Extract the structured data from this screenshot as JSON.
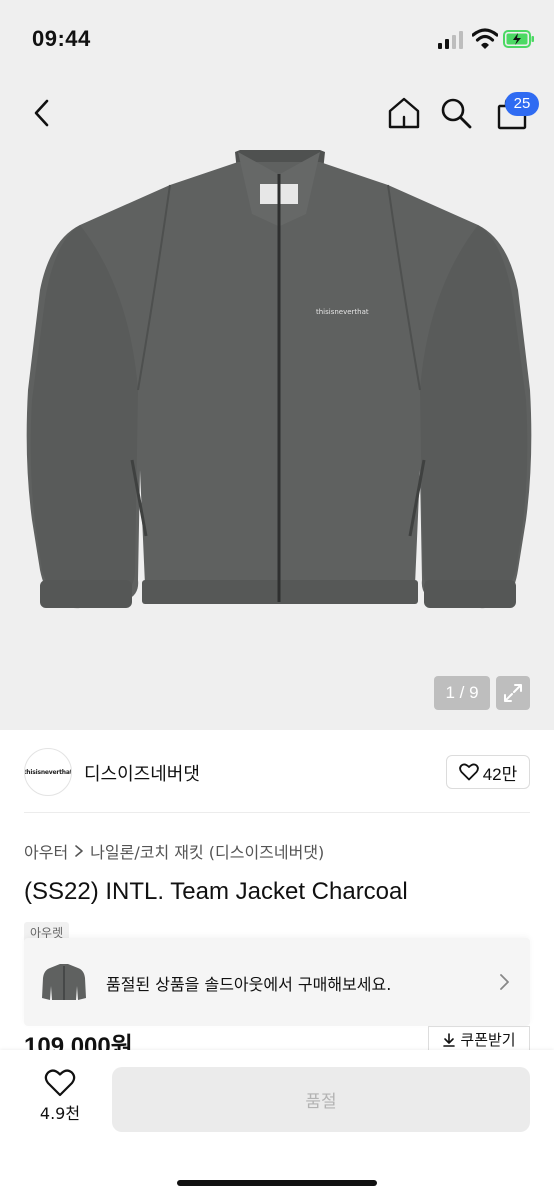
{
  "status_bar": {
    "time": "09:44"
  },
  "nav": {
    "cart_count": "25"
  },
  "gallery": {
    "counter": "1 / 9",
    "jacket_logo_text": "thisisneverthat"
  },
  "brand": {
    "logo_text": "thisisneverthat",
    "name": "디스이즈네버댓",
    "likes": "42만"
  },
  "breadcrumb": {
    "category": "아우터",
    "subcategory": "나일론/코치 재킷 (디스이즈네버댓)"
  },
  "product": {
    "title": "(SS22) INTL. Team Jacket Charcoal",
    "tag": "아우렛",
    "price": "109,000원"
  },
  "banner": {
    "text": "품절된 상품을 솔드아웃에서 구매해보세요."
  },
  "coupon": {
    "label": "쿠폰받기"
  },
  "bottom": {
    "wish_count": "4.9천",
    "soldout_label": "품절"
  },
  "colors": {
    "accent": "#2f6bf2",
    "jacket": "#5f6160",
    "background": "#efefef"
  }
}
